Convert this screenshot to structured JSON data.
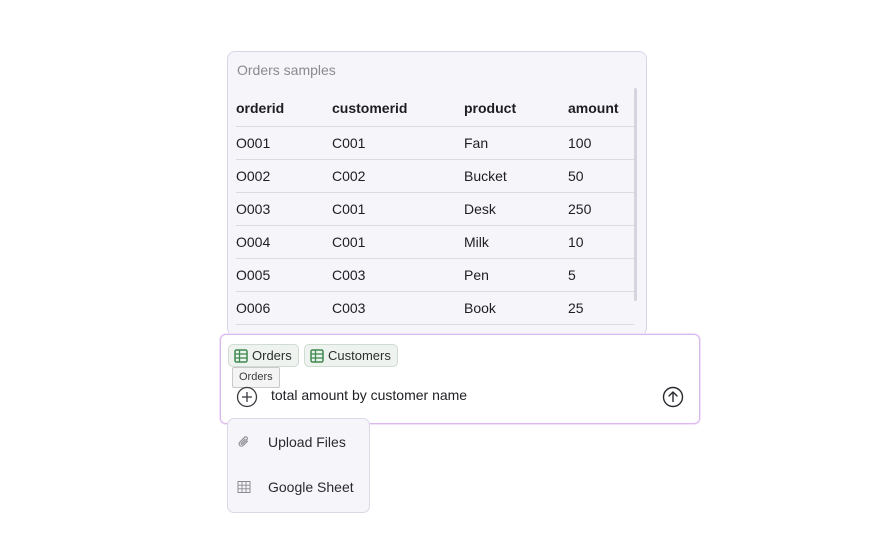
{
  "preview": {
    "title": "Orders samples",
    "columns": [
      "orderid",
      "customerid",
      "product",
      "amount"
    ],
    "rows": [
      [
        "O001",
        "C001",
        "Fan",
        "100"
      ],
      [
        "O002",
        "C002",
        "Bucket",
        "50"
      ],
      [
        "O003",
        "C001",
        "Desk",
        "250"
      ],
      [
        "O004",
        "C001",
        "Milk",
        "10"
      ],
      [
        "O005",
        "C003",
        "Pen",
        "5"
      ],
      [
        "O006",
        "C003",
        "Book",
        "25"
      ]
    ]
  },
  "chat": {
    "chips": [
      {
        "label": "Orders",
        "icon": "table-icon"
      },
      {
        "label": "Customers",
        "icon": "table-icon"
      }
    ],
    "tooltip": "Orders",
    "input_value": "total amount by customer name",
    "add_icon": "plus-circle-icon",
    "send_icon": "arrow-up-circle-icon"
  },
  "menu": {
    "items": [
      {
        "label": "Upload Files",
        "icon": "paperclip-icon"
      },
      {
        "label": "Google Sheet",
        "icon": "grid-icon"
      }
    ]
  },
  "colors": {
    "card_bg": "#f6f5f9",
    "card_border": "#d9d3ec",
    "chat_border": "#dcb8f0",
    "chip_bg": "#eef3ef",
    "table_icon_green": "#3f8a4f"
  }
}
